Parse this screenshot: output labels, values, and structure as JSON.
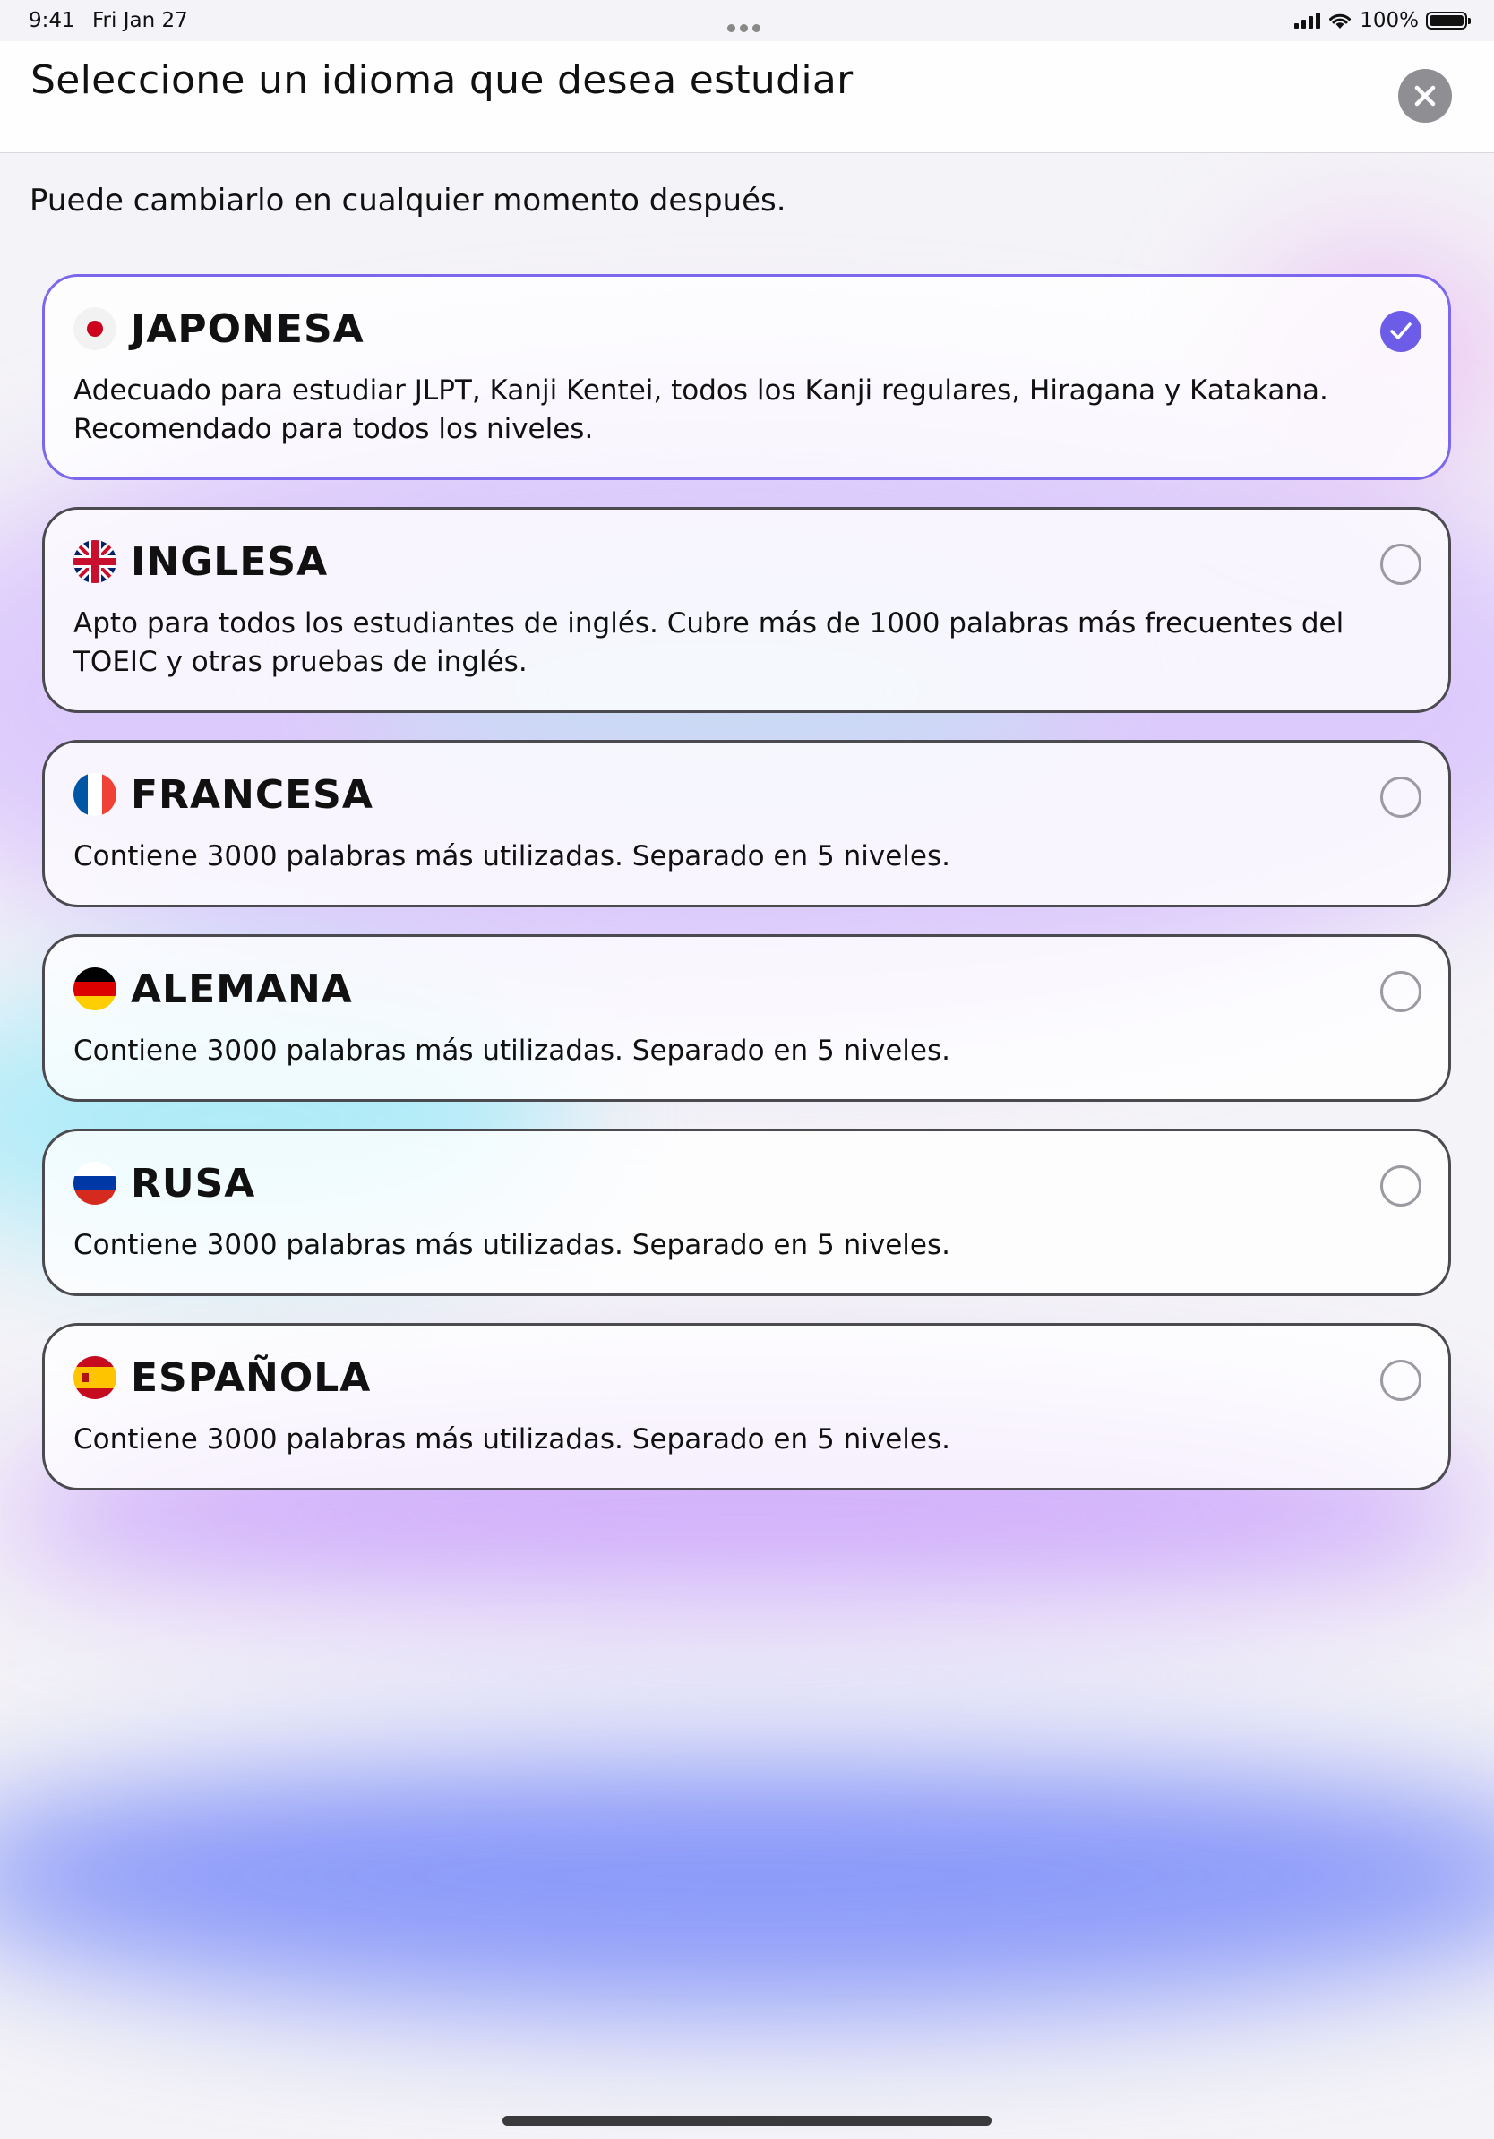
{
  "status_bar": {
    "time": "9:41",
    "date": "Fri Jan 27",
    "battery_text": "100%"
  },
  "header": {
    "title": "Seleccione un idioma que desea estudiar",
    "close_icon": "close-x-icon"
  },
  "subtitle": "Puede cambiarlo en cualquier momento después.",
  "colors": {
    "accent": "#6c5ce7",
    "selected_border": "#7b68ee",
    "card_border": "#4a4a4f"
  },
  "languages": [
    {
      "name": "JAPONESA",
      "flag": "japan-flag-icon",
      "description": "Adecuado para estudiar JLPT, Kanji Kentei, todos los Kanji regulares, Hiragana y Katakana. Recomendado para todos los niveles.",
      "selected": true
    },
    {
      "name": "INGLESA",
      "flag": "uk-flag-icon",
      "description": "Apto para todos los estudiantes de inglés. Cubre más de 1000 palabras más frecuentes del TOEIC y otras pruebas de inglés.",
      "selected": false
    },
    {
      "name": "FRANCESA",
      "flag": "france-flag-icon",
      "description": "Contiene 3000 palabras más utilizadas. Separado en 5 niveles.",
      "selected": false
    },
    {
      "name": "ALEMANA",
      "flag": "germany-flag-icon",
      "description": "Contiene 3000 palabras más utilizadas. Separado en 5 niveles.",
      "selected": false
    },
    {
      "name": "RUSA",
      "flag": "russia-flag-icon",
      "description": "Contiene 3000 palabras más utilizadas. Separado en 5 niveles.",
      "selected": false
    },
    {
      "name": "ESPAÑOLA",
      "flag": "spain-flag-icon",
      "description": "Contiene 3000 palabras más utilizadas. Separado en 5 niveles.",
      "selected": false
    }
  ]
}
